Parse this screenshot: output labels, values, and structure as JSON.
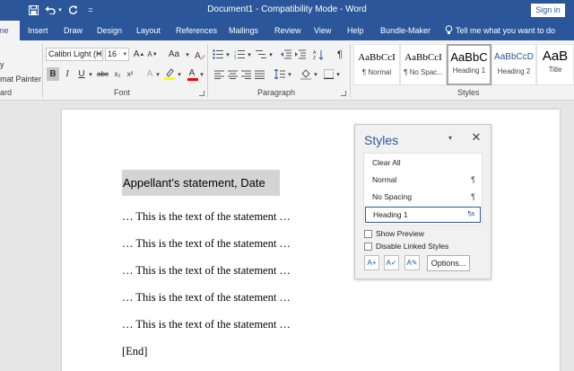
{
  "window": {
    "title": "Document1  -  Compatibility Mode  -  Word",
    "sign_in": "Sign in",
    "dropdown_glyph": "="
  },
  "tabs": [
    {
      "label": "me",
      "active": true
    },
    {
      "label": "Insert"
    },
    {
      "label": "Draw"
    },
    {
      "label": "Design"
    },
    {
      "label": "Layout"
    },
    {
      "label": "References"
    },
    {
      "label": "Mailings"
    },
    {
      "label": "Review"
    },
    {
      "label": "View"
    },
    {
      "label": "Help"
    },
    {
      "label": "Bundle-Maker"
    }
  ],
  "tell_me": "Tell me what you want to do",
  "ribbon": {
    "clipboard": {
      "copy_fragment": "y",
      "format_painter": "mat Painter",
      "group_label": "ard"
    },
    "font": {
      "name": "Calibri Light (H",
      "size": "16",
      "grow": "A",
      "shrink": "A",
      "case": "Aa",
      "bold": "B",
      "italic": "I",
      "underline": "U",
      "strikethrough": "abc",
      "subscript": "x₂",
      "superscript": "x²",
      "text_effects": "A",
      "font_color": "A",
      "group_label": "Font"
    },
    "paragraph": {
      "group_label": "Paragraph",
      "pilcrow": "¶"
    },
    "styles": {
      "group_label": "Styles",
      "gallery": [
        {
          "sample": "AaBbCcI",
          "name": "¶ Normal"
        },
        {
          "sample": "AaBbCcI",
          "name": "¶ No Spac..."
        },
        {
          "sample": "AaBbC",
          "name": "Heading 1",
          "selected": true
        },
        {
          "sample": "AaBbCcD",
          "name": "Heading 2"
        },
        {
          "sample": "AaB",
          "name": "Title"
        }
      ]
    }
  },
  "document": {
    "heading": "Appellant’s statement, Date",
    "paragraphs": [
      "… This is the text of the statement …",
      "… This is the text of the statement …",
      "… This is the text of the statement …",
      "… This is the text of the statement …",
      "… This is the text of the statement …"
    ],
    "end": "[End]"
  },
  "styles_pane": {
    "title": "Styles",
    "items": [
      {
        "label": "Clear All",
        "mark": ""
      },
      {
        "label": "Normal",
        "mark": "¶"
      },
      {
        "label": "No Spacing",
        "mark": "¶"
      },
      {
        "label": "Heading 1",
        "mark": "¶a",
        "selected": true
      }
    ],
    "show_preview": "Show Preview",
    "disable_linked": "Disable Linked Styles",
    "options": "Options...",
    "icon_buttons": [
      {
        "glyph": "A+",
        "name": "new-style-icon"
      },
      {
        "glyph": "A✓",
        "name": "style-inspector-icon"
      },
      {
        "glyph": "A✎",
        "name": "manage-styles-icon"
      }
    ]
  },
  "colors": {
    "brand_blue": "#2b579a",
    "highlight_yellow": "#ffff00",
    "font_color_red": "#ff0000"
  }
}
